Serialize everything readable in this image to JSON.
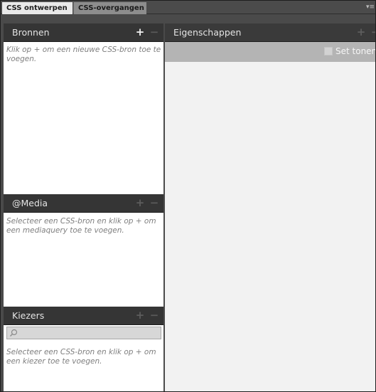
{
  "tabs": [
    {
      "label": "CSS ontwerpen",
      "active": true
    },
    {
      "label": "CSS-overgangen",
      "active": false
    }
  ],
  "panel_menu_icon": "panel-menu-icon",
  "sources": {
    "title": "Bronnen",
    "add_icon": "plus-icon",
    "remove_icon": "minus-icon",
    "hint": "Klik op + om een nieuwe CSS-bron toe te voegen."
  },
  "media": {
    "title": "@Media",
    "add_icon": "plus-icon",
    "remove_icon": "minus-icon",
    "hint": "Selecteer een CSS-bron en klik op + om een mediaquery toe te voegen."
  },
  "selectors": {
    "title": "Kiezers",
    "add_icon": "plus-icon",
    "remove_icon": "minus-icon",
    "search_value": "",
    "search_icon": "search-icon",
    "hint": "Selecteer een CSS-bron en klik op + om een kiezer toe te voegen."
  },
  "properties": {
    "title": "Eigenschappen",
    "add_icon": "plus-icon",
    "remove_icon": "minus-icon",
    "show_set_label": "Set tonen",
    "show_set_checked": false
  },
  "colors": {
    "panel_bg": "#4a4a4a",
    "header_bg": "#353535",
    "subbar_bg": "#b4b4b4",
    "content_bg": "#f2f2f2",
    "hint_text": "#7f7f7f"
  }
}
